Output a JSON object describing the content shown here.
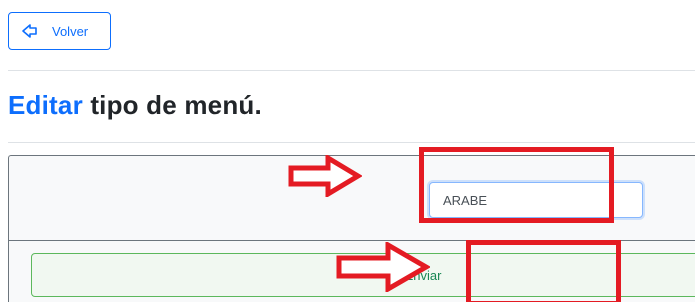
{
  "toolbar": {
    "back_label": "Volver"
  },
  "page": {
    "title_accent": "Editar",
    "title_rest": " tipo de menú."
  },
  "form": {
    "name_value": "ARABE",
    "submit_label": "Enviar"
  },
  "colors": {
    "primary": "#0d6efd",
    "success": "#198754",
    "annotation": "#e41b23"
  },
  "icons": {
    "back": "arrow-left-outline-icon",
    "annotation": "outline-arrow-right-icon"
  }
}
